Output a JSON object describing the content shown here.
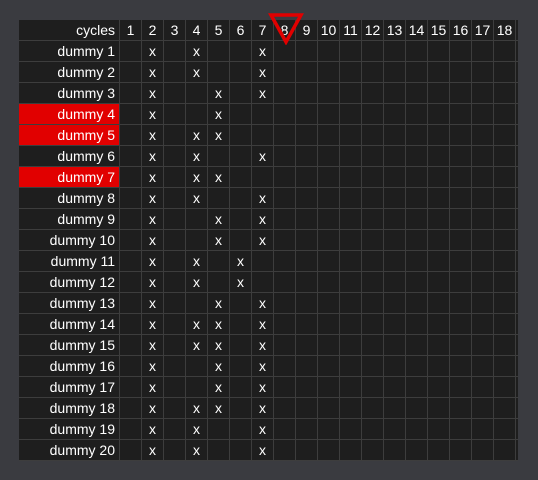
{
  "header_label": "cycles",
  "cycles": [
    "1",
    "2",
    "3",
    "4",
    "5",
    "6",
    "7",
    "8",
    "9",
    "10",
    "11",
    "12",
    "13",
    "14",
    "15",
    "16",
    "17",
    "18"
  ],
  "current_cycle": "8",
  "colors": {
    "highlight": "#e10000",
    "marker": "#e10000",
    "grid_bg": "#1e1e1e",
    "page_bg": "#3a3b40"
  },
  "marker_icon": "triangle-down-icon",
  "rows": [
    {
      "label": "dummy 1",
      "hl": false,
      "cells": [
        "",
        "x",
        "",
        "x",
        "",
        "",
        "x",
        "",
        "",
        "",
        "",
        "",
        "",
        "",
        "",
        "",
        "",
        ""
      ]
    },
    {
      "label": "dummy 2",
      "hl": false,
      "cells": [
        "",
        "x",
        "",
        "x",
        "",
        "",
        "x",
        "",
        "",
        "",
        "",
        "",
        "",
        "",
        "",
        "",
        "",
        ""
      ]
    },
    {
      "label": "dummy 3",
      "hl": false,
      "cells": [
        "",
        "x",
        "",
        "",
        "x",
        "",
        "x",
        "",
        "",
        "",
        "",
        "",
        "",
        "",
        "",
        "",
        "",
        ""
      ]
    },
    {
      "label": "dummy 4",
      "hl": true,
      "cells": [
        "",
        "x",
        "",
        "",
        "x",
        "",
        "",
        "",
        "",
        "",
        "",
        "",
        "",
        "",
        "",
        "",
        "",
        ""
      ]
    },
    {
      "label": "dummy 5",
      "hl": true,
      "cells": [
        "",
        "x",
        "",
        "x",
        "x",
        "",
        "",
        "",
        "",
        "",
        "",
        "",
        "",
        "",
        "",
        "",
        "",
        ""
      ]
    },
    {
      "label": "dummy 6",
      "hl": false,
      "cells": [
        "",
        "x",
        "",
        "x",
        "",
        "",
        "x",
        "",
        "",
        "",
        "",
        "",
        "",
        "",
        "",
        "",
        "",
        ""
      ]
    },
    {
      "label": "dummy 7",
      "hl": true,
      "cells": [
        "",
        "x",
        "",
        "x",
        "x",
        "",
        "",
        "",
        "",
        "",
        "",
        "",
        "",
        "",
        "",
        "",
        "",
        ""
      ]
    },
    {
      "label": "dummy 8",
      "hl": false,
      "cells": [
        "",
        "x",
        "",
        "x",
        "",
        "",
        "x",
        "",
        "",
        "",
        "",
        "",
        "",
        "",
        "",
        "",
        "",
        ""
      ]
    },
    {
      "label": "dummy 9",
      "hl": false,
      "cells": [
        "",
        "x",
        "",
        "",
        "x",
        "",
        "x",
        "",
        "",
        "",
        "",
        "",
        "",
        "",
        "",
        "",
        "",
        ""
      ]
    },
    {
      "label": "dummy 10",
      "hl": false,
      "cells": [
        "",
        "x",
        "",
        "",
        "x",
        "",
        "x",
        "",
        "",
        "",
        "",
        "",
        "",
        "",
        "",
        "",
        "",
        ""
      ]
    },
    {
      "label": "dummy 11",
      "hl": false,
      "cells": [
        "",
        "x",
        "",
        "x",
        "",
        "x",
        "",
        "",
        "",
        "",
        "",
        "",
        "",
        "",
        "",
        "",
        "",
        ""
      ]
    },
    {
      "label": "dummy 12",
      "hl": false,
      "cells": [
        "",
        "x",
        "",
        "x",
        "",
        "x",
        "",
        "",
        "",
        "",
        "",
        "",
        "",
        "",
        "",
        "",
        "",
        ""
      ]
    },
    {
      "label": "dummy 13",
      "hl": false,
      "cells": [
        "",
        "x",
        "",
        "",
        "x",
        "",
        "x",
        "",
        "",
        "",
        "",
        "",
        "",
        "",
        "",
        "",
        "",
        ""
      ]
    },
    {
      "label": "dummy 14",
      "hl": false,
      "cells": [
        "",
        "x",
        "",
        "x",
        "x",
        "",
        "x",
        "",
        "",
        "",
        "",
        "",
        "",
        "",
        "",
        "",
        "",
        ""
      ]
    },
    {
      "label": "dummy 15",
      "hl": false,
      "cells": [
        "",
        "x",
        "",
        "x",
        "x",
        "",
        "x",
        "",
        "",
        "",
        "",
        "",
        "",
        "",
        "",
        "",
        "",
        ""
      ]
    },
    {
      "label": "dummy 16",
      "hl": false,
      "cells": [
        "",
        "x",
        "",
        "",
        "x",
        "",
        "x",
        "",
        "",
        "",
        "",
        "",
        "",
        "",
        "",
        "",
        "",
        ""
      ]
    },
    {
      "label": "dummy 17",
      "hl": false,
      "cells": [
        "",
        "x",
        "",
        "",
        "x",
        "",
        "x",
        "",
        "",
        "",
        "",
        "",
        "",
        "",
        "",
        "",
        "",
        ""
      ]
    },
    {
      "label": "dummy 18",
      "hl": false,
      "cells": [
        "",
        "x",
        "",
        "x",
        "x",
        "",
        "x",
        "",
        "",
        "",
        "",
        "",
        "",
        "",
        "",
        "",
        "",
        ""
      ]
    },
    {
      "label": "dummy 19",
      "hl": false,
      "cells": [
        "",
        "x",
        "",
        "x",
        "",
        "",
        "x",
        "",
        "",
        "",
        "",
        "",
        "",
        "",
        "",
        "",
        "",
        ""
      ]
    },
    {
      "label": "dummy 20",
      "hl": false,
      "cells": [
        "",
        "x",
        "",
        "x",
        "",
        "",
        "x",
        "",
        "",
        "",
        "",
        "",
        "",
        "",
        "",
        "",
        "",
        ""
      ]
    }
  ]
}
